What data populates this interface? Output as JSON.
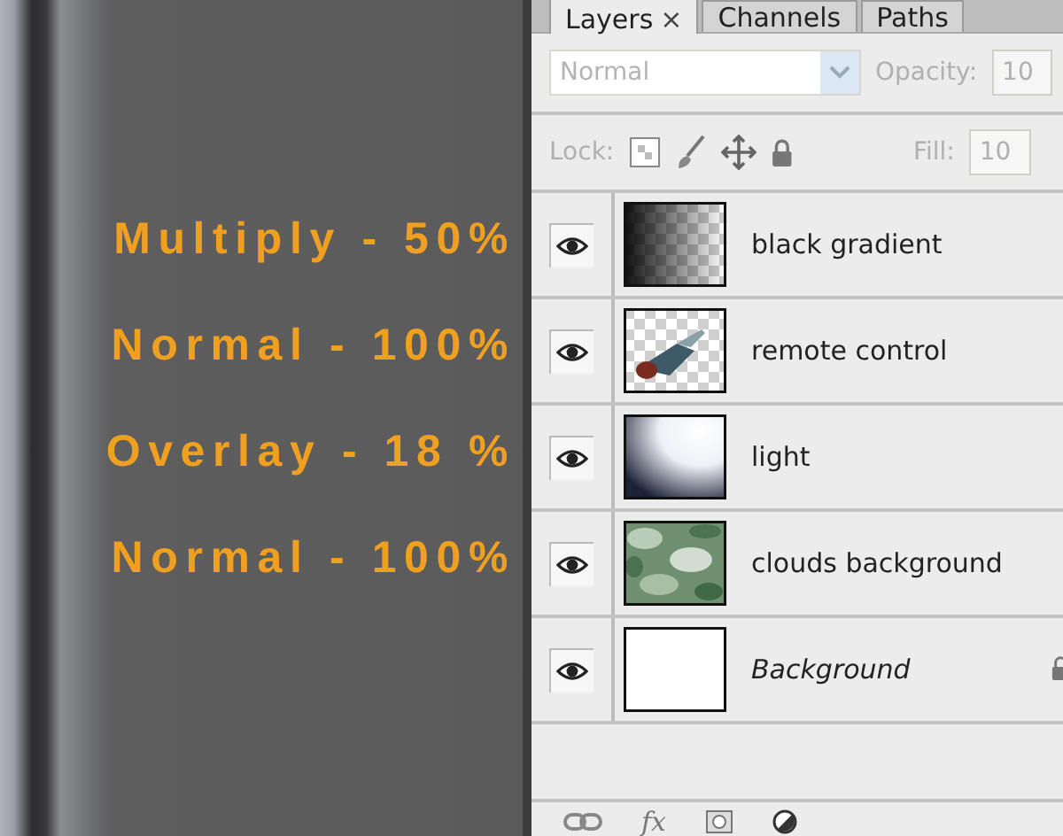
{
  "tabs": [
    {
      "label": "Layers",
      "close": "×",
      "selected": true
    },
    {
      "label": "Channels",
      "selected": false
    },
    {
      "label": "Paths",
      "selected": false
    }
  ],
  "blend_mode": {
    "value": "Normal",
    "disabled": true
  },
  "opacity": {
    "label": "Opacity:",
    "value": "10"
  },
  "lock": {
    "label": "Lock:"
  },
  "fill": {
    "label": "Fill:",
    "value": "10"
  },
  "layers": [
    {
      "name": "black gradient",
      "kind": "layer",
      "thumbnail": {
        "kind": "gradient"
      },
      "visible": true,
      "note": "Multiply - 50%"
    },
    {
      "name": "remote control",
      "kind": "layer",
      "thumbnail": {
        "kind": "object"
      },
      "visible": true,
      "note": "Normal - 100%"
    },
    {
      "name": "light",
      "kind": "layer",
      "thumbnail": {
        "kind": "light"
      },
      "visible": true,
      "note": "Overlay - 18 %"
    },
    {
      "name": "clouds background",
      "kind": "layer",
      "thumbnail": {
        "kind": "clouds"
      },
      "visible": true,
      "note": "Normal - 100%"
    },
    {
      "name": "Background",
      "kind": "background",
      "thumbnail": {
        "kind": "white"
      },
      "visible": true
    }
  ],
  "footer": {
    "fx": "fx"
  }
}
